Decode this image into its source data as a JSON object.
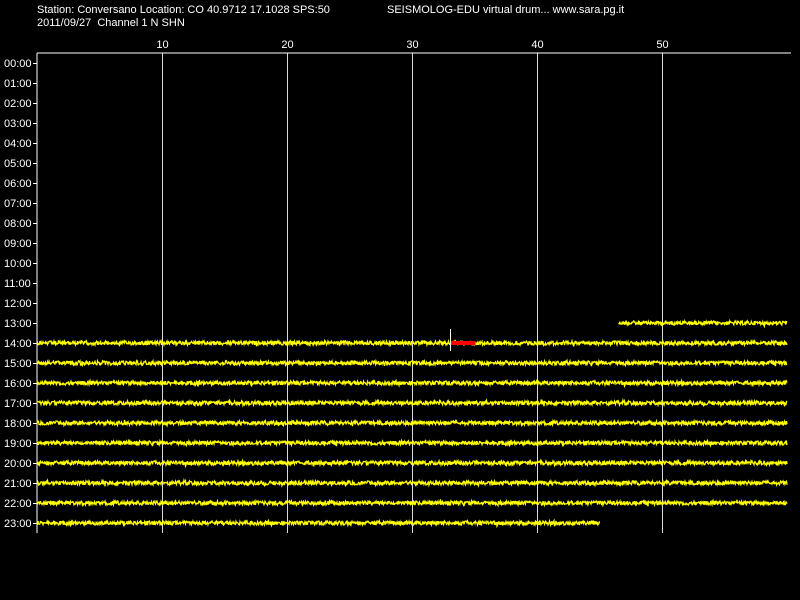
{
  "header": {
    "station_line": "Station: Conversano Location: CO 40.9712 17.1028 SPS:50",
    "title_right": "SEISMOLOG-EDU virtual drum... www.sara.pg.it",
    "date_channel": "2011/09/27  Channel 1 N SHN"
  },
  "colors": {
    "background": "#000000",
    "trace": "#ffff00",
    "event": "#ff0000",
    "grid": "#ffffff"
  },
  "chart_data": {
    "type": "line",
    "title": "",
    "xlabel": "",
    "ylabel": "",
    "x_ticks": [
      10,
      20,
      30,
      40,
      50
    ],
    "xlim": [
      0,
      60
    ],
    "grid": true,
    "hour_labels": [
      "00:00",
      "01:00",
      "02:00",
      "03:00",
      "04:00",
      "05:00",
      "06:00",
      "07:00",
      "08:00",
      "09:00",
      "10:00",
      "11:00",
      "12:00",
      "13:00",
      "14:00",
      "15:00",
      "16:00",
      "17:00",
      "18:00",
      "19:00",
      "20:00",
      "21:00",
      "22:00",
      "23:00"
    ],
    "traces": [
      {
        "hour": "13:00",
        "start_min": 46.5,
        "end_min": 60
      },
      {
        "hour": "14:00",
        "start_min": 0,
        "end_min": 60
      },
      {
        "hour": "15:00",
        "start_min": 0,
        "end_min": 60
      },
      {
        "hour": "16:00",
        "start_min": 0,
        "end_min": 60
      },
      {
        "hour": "17:00",
        "start_min": 0,
        "end_min": 60
      },
      {
        "hour": "18:00",
        "start_min": 0,
        "end_min": 60
      },
      {
        "hour": "19:00",
        "start_min": 0,
        "end_min": 60
      },
      {
        "hour": "20:00",
        "start_min": 0,
        "end_min": 60
      },
      {
        "hour": "21:00",
        "start_min": 0,
        "end_min": 60
      },
      {
        "hour": "22:00",
        "start_min": 0,
        "end_min": 60
      },
      {
        "hour": "23:00",
        "start_min": 0,
        "end_min": 45
      }
    ],
    "events": [
      {
        "hour": "14:00",
        "start_min": 33,
        "end_min": 35
      }
    ]
  }
}
